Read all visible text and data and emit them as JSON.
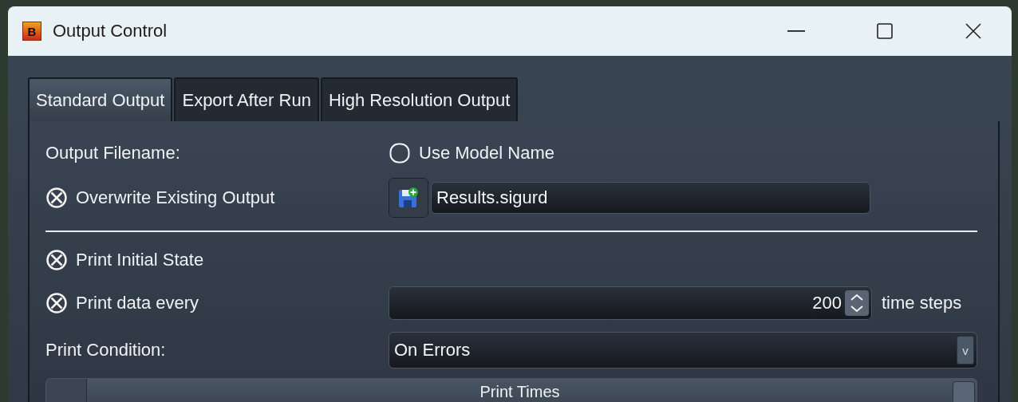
{
  "window": {
    "title": "Output Control",
    "icon_letter": "B"
  },
  "tabs": [
    {
      "label": "Standard Output",
      "selected": true
    },
    {
      "label": "Export After Run",
      "selected": false
    },
    {
      "label": "High Resolution Output",
      "selected": false
    }
  ],
  "output_filename_label": "Output Filename:",
  "use_model_name": {
    "label": "Use Model Name",
    "checked": false
  },
  "overwrite_existing_output": {
    "label": "Overwrite Existing Output",
    "checked": true
  },
  "filename_field": {
    "value": "Results.sigurd"
  },
  "print_initial_state": {
    "label": "Print Initial State",
    "checked": true
  },
  "print_data_every": {
    "label": "Print data every",
    "checked": true,
    "value": "200",
    "unit": "time steps"
  },
  "print_condition": {
    "label": "Print Condition:",
    "value": "On Errors",
    "arrow": "v"
  },
  "print_times": {
    "label": "Print Times"
  }
}
